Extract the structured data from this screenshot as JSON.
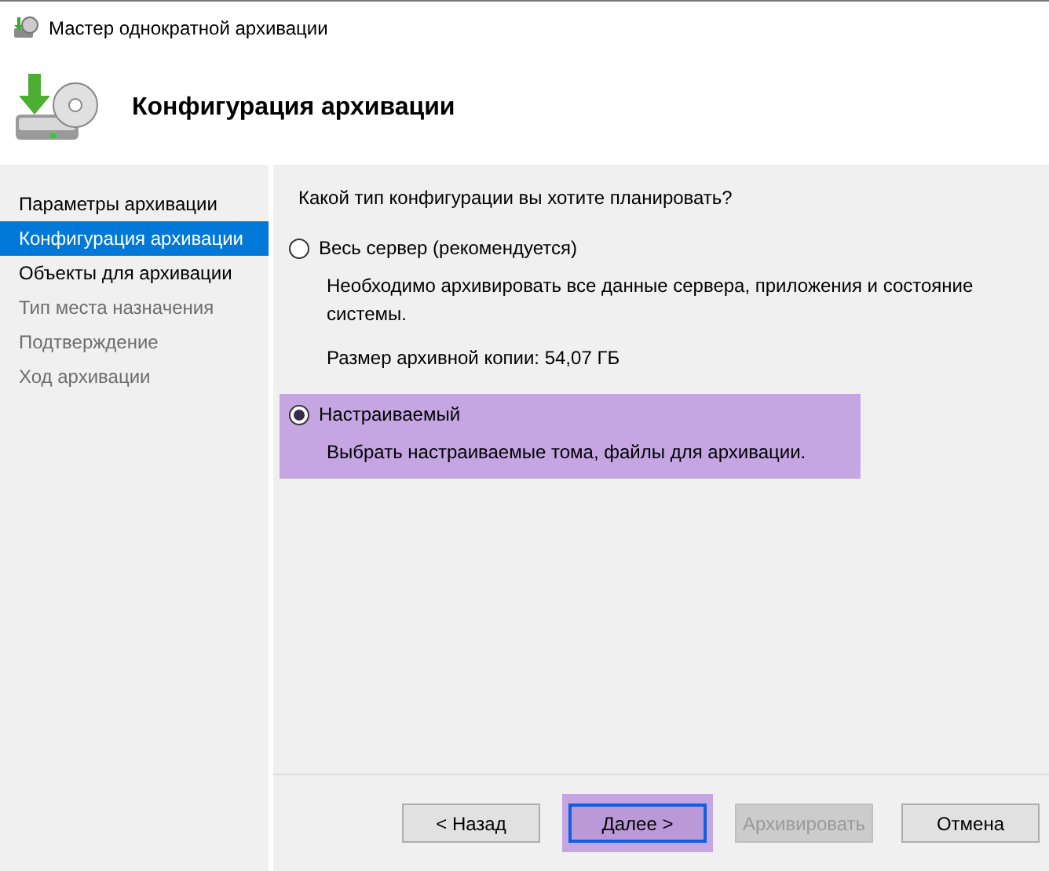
{
  "window": {
    "title": "Мастер однократной архивации"
  },
  "header": {
    "title": "Конфигурация архивации"
  },
  "sidebar": {
    "items": [
      {
        "label": "Параметры архивации",
        "selected": false,
        "disabled": false
      },
      {
        "label": "Конфигурация архивации",
        "selected": true,
        "disabled": false
      },
      {
        "label": "Объекты для архивации",
        "selected": false,
        "disabled": false
      },
      {
        "label": "Тип места назначения",
        "selected": false,
        "disabled": true
      },
      {
        "label": "Подтверждение",
        "selected": false,
        "disabled": true
      },
      {
        "label": "Ход архивации",
        "selected": false,
        "disabled": true
      }
    ]
  },
  "question": "Какой тип конфигурации вы хотите планировать?",
  "options": [
    {
      "label": "Весь сервер (рекомендуется)",
      "selected": false,
      "highlighted": false,
      "description": "Необходимо архивировать все данные сервера, приложения и состояние системы.",
      "note": "Размер архивной копии: 54,07 ГБ"
    },
    {
      "label": "Настраиваемый",
      "selected": true,
      "highlighted": true,
      "description": "Выбрать настраиваемые тома, файлы для архивации."
    }
  ],
  "buttons": [
    {
      "label": "< Назад",
      "disabled": false,
      "focused": false,
      "highlighted": false
    },
    {
      "label": "Далее >",
      "disabled": false,
      "focused": true,
      "highlighted": true
    },
    {
      "label": "Архивировать",
      "disabled": true,
      "focused": false,
      "highlighted": false
    },
    {
      "label": "Отмена",
      "disabled": false,
      "focused": false,
      "highlighted": false
    }
  ]
}
